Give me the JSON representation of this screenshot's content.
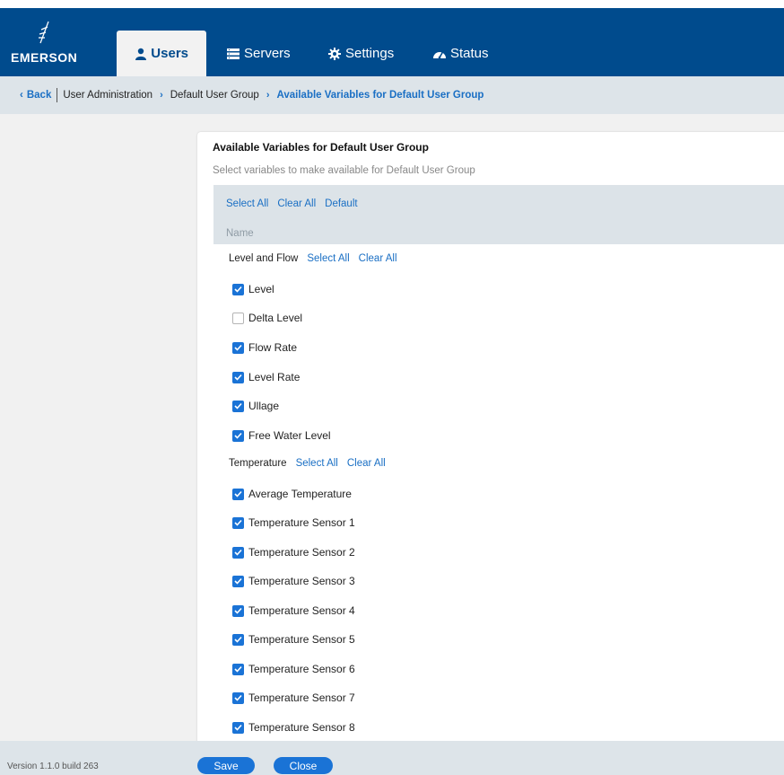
{
  "brand": {
    "name": "EMERSON"
  },
  "nav": {
    "tabs": [
      {
        "label": "Users",
        "icon": "user-icon",
        "active": true
      },
      {
        "label": "Servers",
        "icon": "server-list-icon",
        "active": false
      },
      {
        "label": "Settings",
        "icon": "gear-icon",
        "active": false
      },
      {
        "label": "Status",
        "icon": "gauge-icon",
        "active": false
      }
    ]
  },
  "breadcrumb": {
    "back": "Back",
    "items": [
      "User Administration",
      "Default User Group",
      "Available Variables for Default User Group"
    ]
  },
  "dialog": {
    "title": "Available Variables for Default User Group",
    "subtitle": "Select variables to make available for Default User Group",
    "toolbar": {
      "select_all": "Select All",
      "clear_all": "Clear All",
      "default": "Default"
    },
    "column_header": "Name",
    "groups": [
      {
        "name": "Level and Flow",
        "select_all": "Select All",
        "clear_all": "Clear All",
        "items": [
          {
            "label": "Level",
            "checked": true
          },
          {
            "label": "Delta Level",
            "checked": false
          },
          {
            "label": "Flow Rate",
            "checked": true
          },
          {
            "label": "Level Rate",
            "checked": true
          },
          {
            "label": "Ullage",
            "checked": true
          },
          {
            "label": "Free Water Level",
            "checked": true
          }
        ]
      },
      {
        "name": "Temperature",
        "select_all": "Select All",
        "clear_all": "Clear All",
        "items": [
          {
            "label": "Average Temperature",
            "checked": true
          },
          {
            "label": "Temperature Sensor 1",
            "checked": true
          },
          {
            "label": "Temperature Sensor 2",
            "checked": true
          },
          {
            "label": "Temperature Sensor 3",
            "checked": true
          },
          {
            "label": "Temperature Sensor 4",
            "checked": true
          },
          {
            "label": "Temperature Sensor 5",
            "checked": true
          },
          {
            "label": "Temperature Sensor 6",
            "checked": true
          },
          {
            "label": "Temperature Sensor 7",
            "checked": true
          },
          {
            "label": "Temperature Sensor 8",
            "checked": true
          }
        ]
      }
    ]
  },
  "footer": {
    "version": "Version 1.1.0 build 263",
    "save": "Save",
    "close": "Close"
  },
  "colors": {
    "brand_blue": "#004b8d",
    "accent": "#1a73d6",
    "link": "#1a6fc4",
    "bar_bg": "#dde4e9"
  }
}
